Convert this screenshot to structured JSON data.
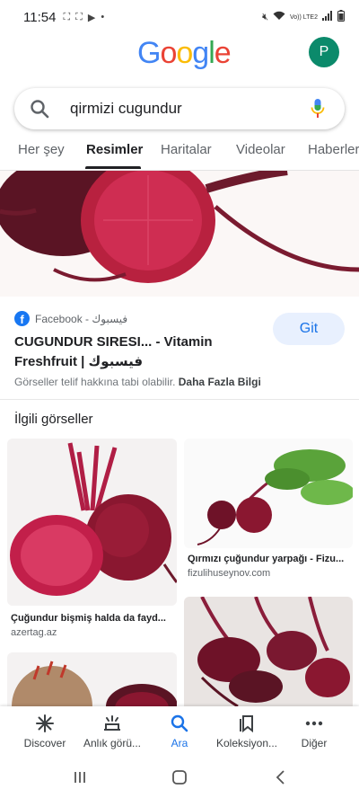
{
  "status_bar": {
    "time": "11:54",
    "network": "Vo)) LTE2"
  },
  "logo_letters": [
    {
      "ch": "G",
      "color": "#4285F4"
    },
    {
      "ch": "o",
      "color": "#EA4335"
    },
    {
      "ch": "o",
      "color": "#FBBC05"
    },
    {
      "ch": "g",
      "color": "#4285F4"
    },
    {
      "ch": "l",
      "color": "#34A853"
    },
    {
      "ch": "e",
      "color": "#EA4335"
    }
  ],
  "avatar_letter": "P",
  "search": {
    "query": "qirmizi cugundur"
  },
  "tabs": [
    "Her şey",
    "Resimler",
    "Haritalar",
    "Videolar",
    "Haberler"
  ],
  "result": {
    "source": "Facebook - فيسبوك",
    "title_line1": "CUGUNDUR SIRESI... - Vitamin",
    "title_line2": "Freshfruit | فيسبوك",
    "button": "Git",
    "copyright": "Görseller telif hakkına tabi olabilir.",
    "more_info": "Daha Fazla Bilgi"
  },
  "related": {
    "heading": "İlgili görseller",
    "cards": [
      {
        "caption": "Çuğundur bişmiş halda da fayd...",
        "domain": "azertag.az"
      },
      {
        "caption": "Qırmızı çuğundur yarpağı - Fizu...",
        "domain": "fizulihuseynov.com"
      }
    ]
  },
  "bottom_nav": [
    "Discover",
    "Anlık görü...",
    "Ara",
    "Koleksiyon...",
    "Diğer"
  ],
  "colors": {
    "accent": "#1a73e8",
    "avatar": "#0b8a6b",
    "beet": "#8e1b3a"
  }
}
